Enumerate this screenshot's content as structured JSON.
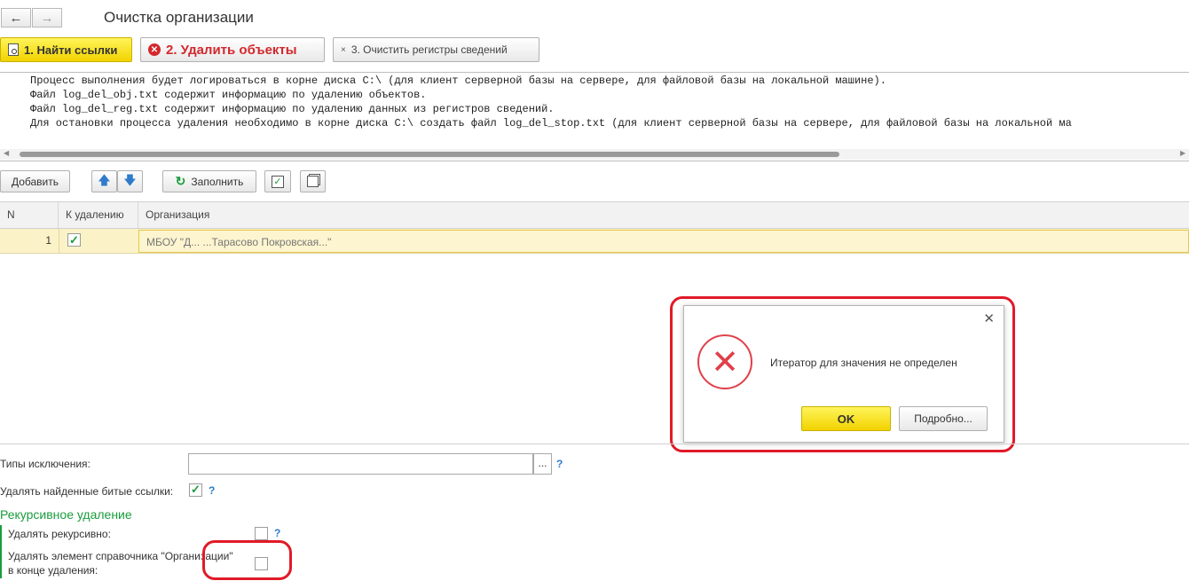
{
  "header": {
    "title": "Очистка организации"
  },
  "actions": {
    "find_links": "1. Найти ссылки",
    "delete_objects": "2. Удалить объекты",
    "clear_registers": "3. Очистить регистры сведений"
  },
  "log": {
    "lines": [
      "Процесс выполнения будет логироваться в корне диска C:\\ (для клиент серверной базы на сервере, для файловой базы на локальной машине).",
      "Файл log_del_obj.txt содержит информацию по удалению объектов.",
      "Файл log_del_reg.txt содержит информацию по удалению данных из регистров сведений.",
      "Для остановки процесса удаления необходимо в корне диска C:\\ создать файл log_del_stop.txt (для клиент серверной базы на сервере, для файловой базы на локальной ма"
    ]
  },
  "toolbar": {
    "add_label": "Добавить",
    "fill_label": "Заполнить"
  },
  "table": {
    "columns": [
      "N",
      "К удалению",
      "Организация"
    ],
    "rows": [
      {
        "n": "1",
        "to_delete": true,
        "organization": "МБОУ \"Д... ...Тарасово Покровская...\""
      }
    ]
  },
  "dialog": {
    "message": "Итератор для значения не определен",
    "ok_label": "OK",
    "details_label": "Подробно..."
  },
  "form": {
    "exclusion_types_label": "Типы исключения:",
    "exclusion_types_value": "",
    "select_button": "...",
    "help": "?",
    "delete_broken_links_label": "Удалять найденные битые ссылки:",
    "delete_broken_links_checked": true,
    "recursive_section_title": "Рекурсивное удаление",
    "delete_recursive_label": "Удалять рекурсивно:",
    "delete_recursive_checked": false,
    "delete_catalog_item_label_1": "Удалять элемент справочника \"Организации\"",
    "delete_catalog_item_label_2": "в конце удаления:",
    "delete_catalog_item_checked": false
  },
  "colors": {
    "accent_yellow": "#f5dc00",
    "annotation_red": "#e01a28",
    "section_green": "#1a9c3c",
    "error_red": "#e0404a"
  }
}
